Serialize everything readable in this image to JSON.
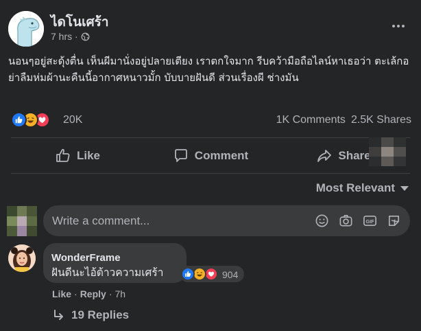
{
  "post": {
    "page_name": "ไดโนเศร้า",
    "timestamp": "7 hrs ·",
    "text": "นอนๆอยู่สะดุ้งตื่น เห็นผีมานั่งอยู่ปลายเตียง เราตกใจมาก รีบคว้ามือถือไลน์หาเธอว่า ตะเล้กอย่าลืมห่มผ้านะคืนนี้อากาศหนาวมั้ก บับบายฝันดี ส่วนเรื่องผี ช่างมัน",
    "reactions": {
      "icons": [
        "like-icon",
        "haha-icon",
        "love-icon"
      ],
      "count": "20K"
    },
    "comments_count": "1K Comments",
    "shares_count": "2.5K Shares"
  },
  "actions": {
    "like": "Like",
    "comment": "Comment",
    "share": "Share"
  },
  "sort": {
    "label": "Most Relevant"
  },
  "comment_input": {
    "placeholder": "Write a comment..."
  },
  "comment": {
    "author": "WonderFrame",
    "text": "ฝันดีนะไอ้ต้าวความเศร้า",
    "reactions": {
      "icons": [
        "like-icon",
        "haha-icon",
        "love-icon"
      ],
      "count": "904"
    },
    "like_label": "Like",
    "separator": "·",
    "reply_label": "Reply",
    "age": "7h"
  },
  "replies": {
    "label": "19 Replies"
  },
  "colors": {
    "background": "#242526",
    "bubble": "#3a3b3c",
    "text_primary": "#e4e6eb",
    "text_secondary": "#b0b3b8",
    "like_blue": "#2078f4",
    "love_red": "#f33e58",
    "haha_yellow": "#f7b125"
  }
}
